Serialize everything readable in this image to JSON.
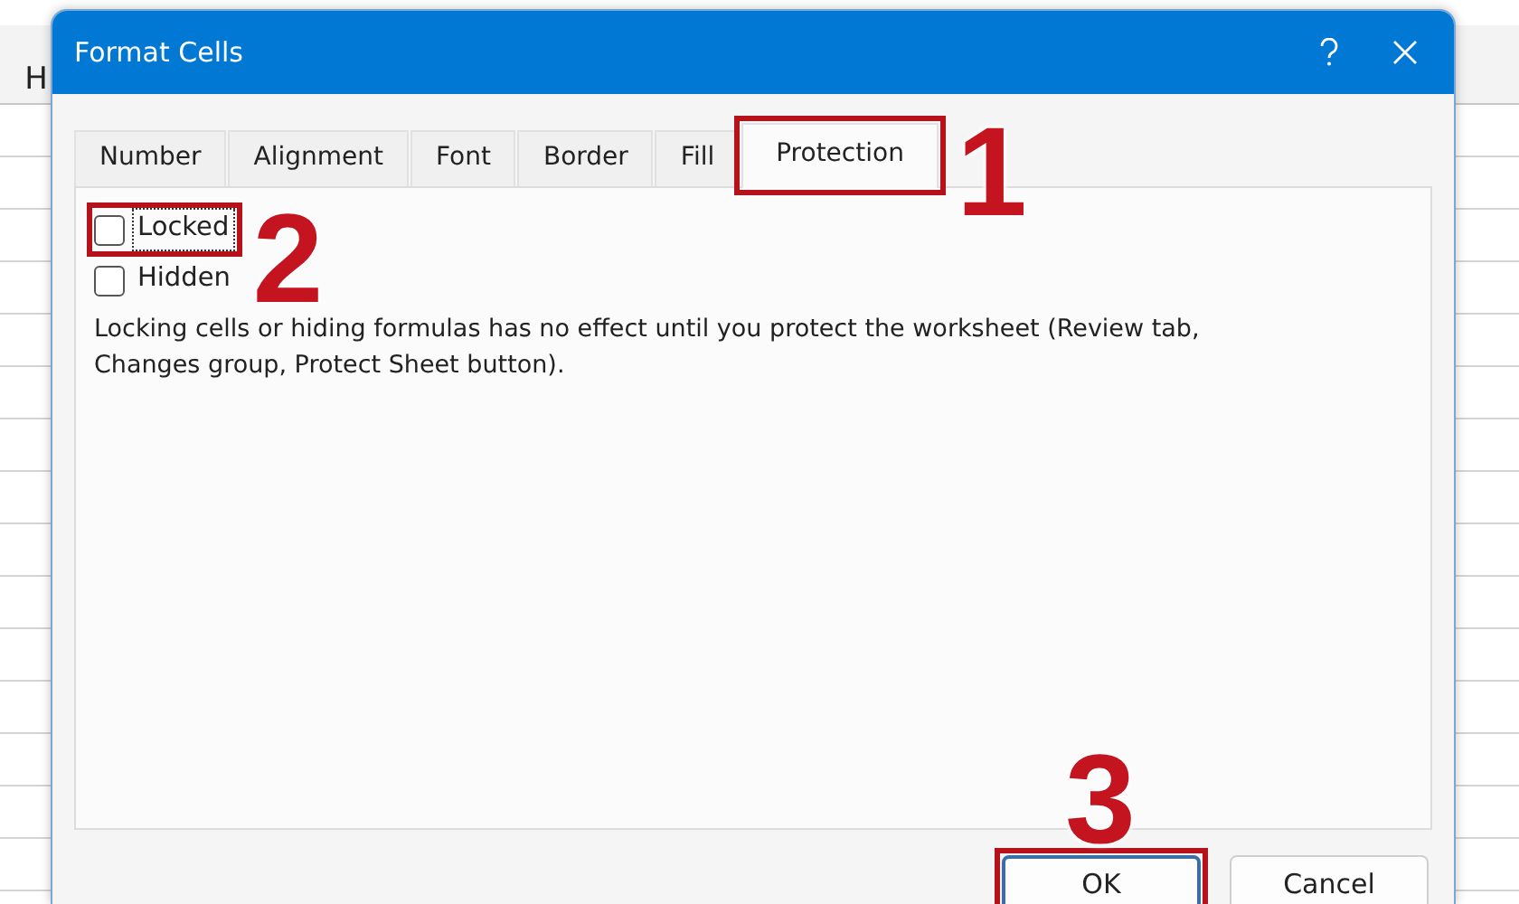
{
  "sheet": {
    "column_header": "H"
  },
  "dialog": {
    "title": "Format Cells",
    "tabs": [
      {
        "label": "Number",
        "selected": false
      },
      {
        "label": "Alignment",
        "selected": false
      },
      {
        "label": "Font",
        "selected": false
      },
      {
        "label": "Border",
        "selected": false
      },
      {
        "label": "Fill",
        "selected": false
      },
      {
        "label": "Protection",
        "selected": true
      }
    ],
    "checkboxes": [
      {
        "label": "Locked",
        "checked": false,
        "focused": true
      },
      {
        "label": "Hidden",
        "checked": false,
        "focused": false
      }
    ],
    "note": "Locking cells or hiding formulas has no effect until you protect the worksheet (Review tab, Changes group, Protect Sheet button).",
    "buttons": [
      {
        "label": "OK",
        "default": true
      },
      {
        "label": "Cancel",
        "default": false
      }
    ]
  },
  "annotations": [
    {
      "number": "1"
    },
    {
      "number": "2"
    },
    {
      "number": "3"
    }
  ]
}
